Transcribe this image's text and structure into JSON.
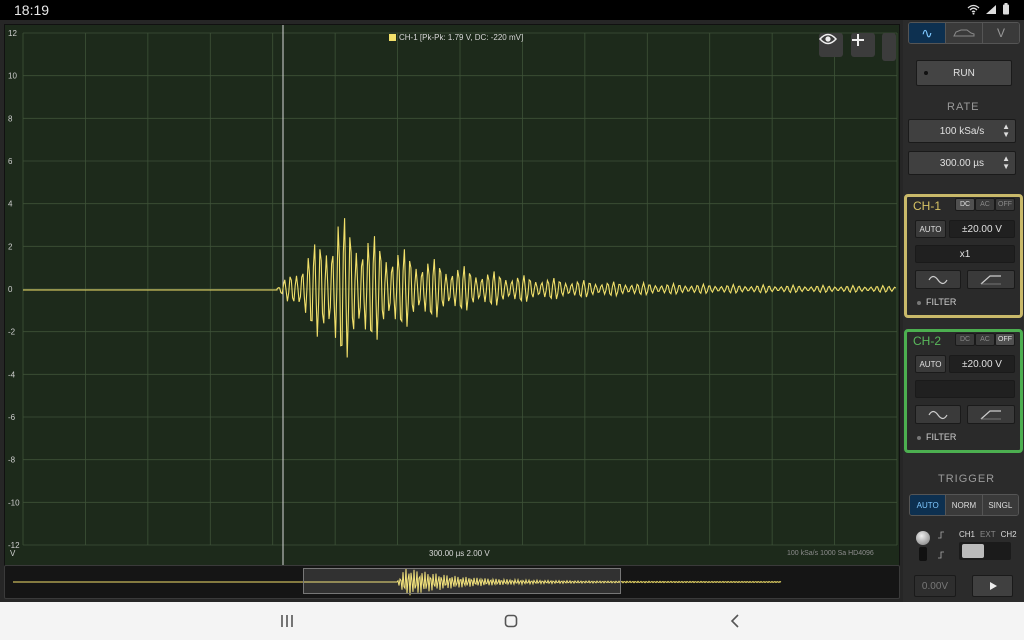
{
  "status": {
    "time": "18:19"
  },
  "scope": {
    "legend": "CH-1 [Pk-Pk: 1.79 V, DC: -220 mV]",
    "y_ticks": [
      "12",
      "10",
      "8",
      "6",
      "4",
      "2",
      "0",
      "-2",
      "-4",
      "-6",
      "-8",
      "-10",
      "-12"
    ],
    "y_unit": "V",
    "timebase": "300.00 µs  2.00 V",
    "footer_info": "100 kSa/s   1000 Sa   HD4096",
    "colors": {
      "trace": "#f2e06a",
      "grid": "#3e5238",
      "bg": "#1d2a1b"
    }
  },
  "panel": {
    "tabs": [
      "∿",
      "",
      "V"
    ],
    "run_label": "RUN",
    "rate_label": "RATE",
    "rate_value": "100 kSa/s",
    "time_value": "300.00 µs",
    "ch1": {
      "name": "CH-1",
      "coupling": [
        "DC",
        "AC",
        "OFF"
      ],
      "auto": "AUTO",
      "range": "±20.00 V",
      "probe": "x1",
      "filter": "FILTER",
      "color": "#c9b96a"
    },
    "ch2": {
      "name": "CH-2",
      "coupling": [
        "DC",
        "AC",
        "OFF"
      ],
      "auto": "AUTO",
      "range": "±20.00 V",
      "probe": "",
      "filter": "FILTER",
      "color": "#4caf50"
    },
    "trigger_label": "TRIGGER",
    "trigger_modes": [
      "AUTO",
      "NORM",
      "SINGL"
    ],
    "trigger_src": [
      "CH1",
      "EXT",
      "CH2"
    ],
    "trigger_level": "0.00V"
  }
}
